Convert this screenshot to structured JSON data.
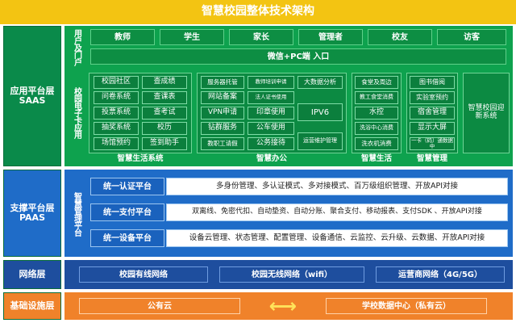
{
  "title": "智慧校园整体技术架构",
  "layers": {
    "app": "应用平台层\nSAAS",
    "support": "支撑平台层\nPAAS",
    "network": "网络层",
    "infra": "基础设施层"
  },
  "users": {
    "label": "用户及门户",
    "items": [
      "教师",
      "学生",
      "家长",
      "管理者",
      "校友",
      "访客"
    ],
    "portal": "微信+PC端 入口"
  },
  "campus_card_label": "校园电子卡应用",
  "group1": {
    "title": "智慧生活系统",
    "left": [
      "校园社区",
      "问卷系统",
      "投票系统",
      "抽奖系统",
      "场馆预约"
    ],
    "right": [
      "查成绩",
      "查课表",
      "查考试",
      "校历",
      "签到助手"
    ]
  },
  "group2": {
    "title": "智慧办公",
    "left": [
      "服务器托管",
      "网站备案",
      "VPN申请",
      "钻群服务",
      "教职工请假"
    ],
    "mid": [
      "教师培训申请",
      "法人证书使用",
      "印章使用",
      "公车使用",
      "公务接待"
    ],
    "right": [
      "大数据分析",
      "IPV6",
      "运营维护管理"
    ]
  },
  "group3": {
    "title": "智慧生活",
    "items": [
      "食堂及周边",
      "教工食堂消费",
      "水控",
      "洗浴中心消费",
      "洗衣机消费"
    ]
  },
  "group4": {
    "title": "智慧管理",
    "items": [
      "图书借阅",
      "实验室预约",
      "宿舍管理",
      "显示大屏",
      "一卡（码）通数据中"
    ]
  },
  "new_system": "智慧校园迎新系统",
  "support_side_label": "智慧管理平台",
  "services": [
    {
      "title": "统一认证平台",
      "content": "多身份管理、多认证模式、多对接模式、百万级组织管理、开放API对接"
    },
    {
      "title": "统一支付平台",
      "content": "双离线、免密代扣、自动垫资、自动分账、聚合支付、移动报表、支付SDK 、开放API对接"
    },
    {
      "title": "统一设备平台",
      "content": "设备云管理、状态管理、配置管理、设备通信、云监控、云升级、云数据、开放API对接"
    }
  ],
  "network": [
    "校园有线网络",
    "校园无线网络（wifi）",
    "运营商网络（4G/5G）"
  ],
  "infra": {
    "left": "公有云",
    "right": "学校数据中心（私有云）",
    "arrow": "⟷"
  },
  "colors": {
    "title_bg": "#f3c412",
    "app_green": "#0ea24e",
    "support_blue": "#1f6cc8",
    "network_blue": "#1e4e9e",
    "infra_orange": "#f0822a"
  }
}
